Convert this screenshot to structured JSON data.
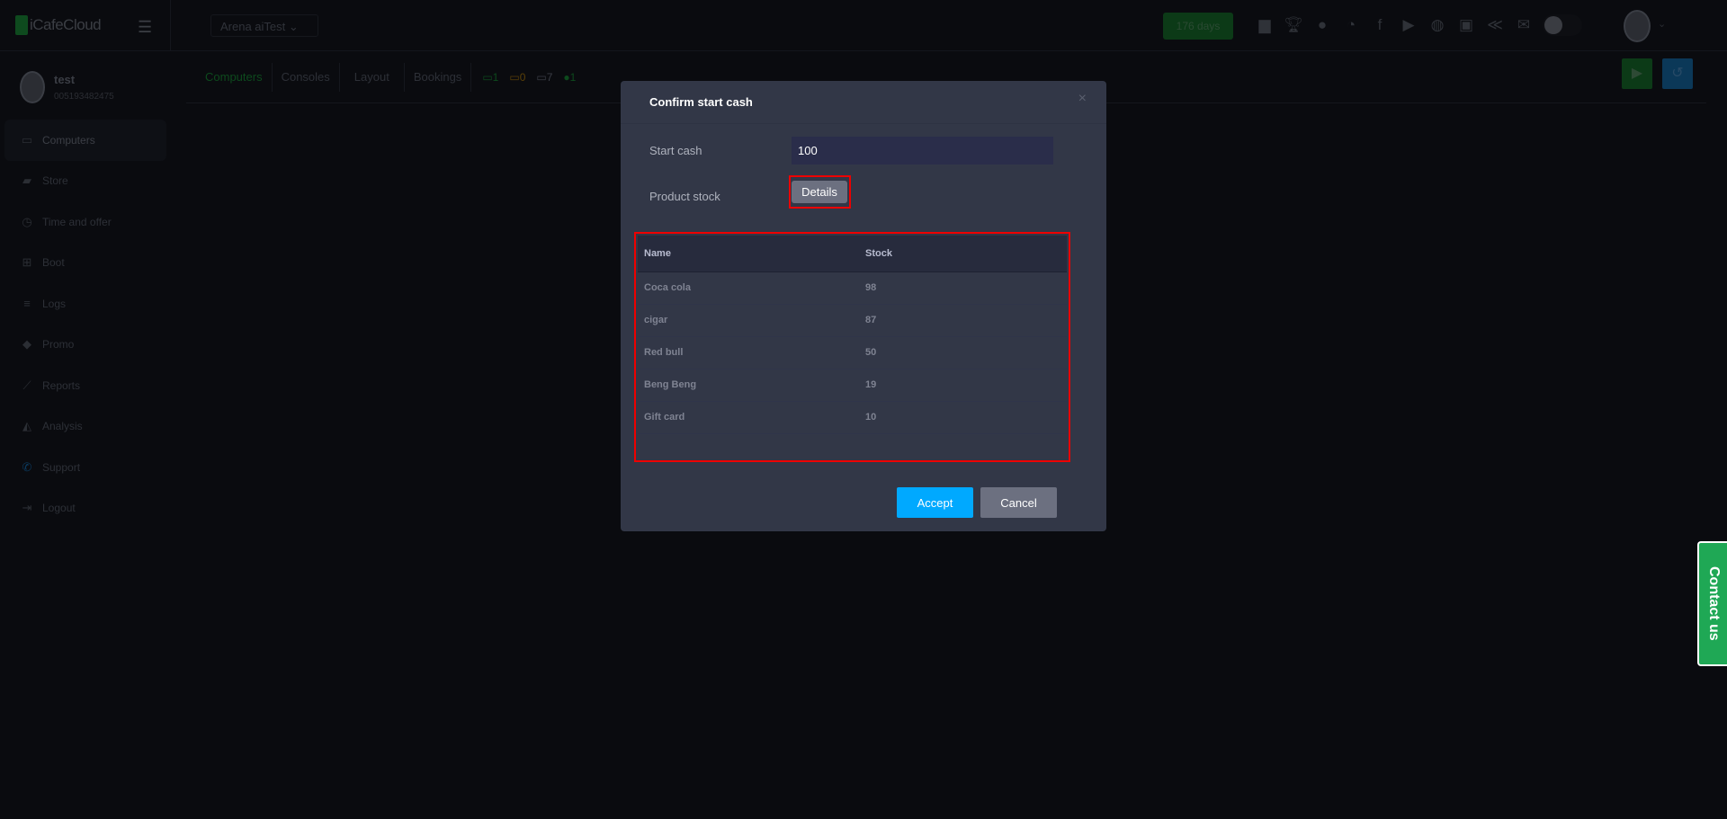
{
  "header": {
    "logo": "iCafeCloud",
    "center": "Arena aiTest",
    "days": "176 days",
    "icons": [
      "ranking-icon",
      "trophy-icon",
      "users-icon",
      "rss-icon",
      "facebook-icon",
      "youtube-icon",
      "globe-icon",
      "icafe-icon",
      "brand-icon",
      "mail-icon"
    ]
  },
  "user": {
    "name": "test",
    "id": "005193482475"
  },
  "sidebar": {
    "items": [
      {
        "label": "Computers",
        "icon": "monitor-icon"
      },
      {
        "label": "Store",
        "icon": "bag-icon"
      },
      {
        "label": "Time and offer",
        "icon": "stopwatch-icon"
      },
      {
        "label": "Boot",
        "icon": "windows-icon"
      },
      {
        "label": "Logs",
        "icon": "list-icon"
      },
      {
        "label": "Promo",
        "icon": "tag-icon"
      },
      {
        "label": "Reports",
        "icon": "chart-icon"
      },
      {
        "label": "Analysis",
        "icon": "area-chart-icon"
      },
      {
        "label": "Support",
        "icon": "phone-icon"
      },
      {
        "label": "Logout",
        "icon": "logout-icon"
      }
    ]
  },
  "tabs": [
    "Computers",
    "Consoles",
    "Layout",
    "Bookings"
  ],
  "stats": [
    {
      "value": "1",
      "color": "#0d4a1d"
    },
    {
      "value": "0",
      "color": "#5a4008"
    },
    {
      "value": "7",
      "color": "#3a3d45"
    },
    {
      "value": "1",
      "color": "#0d4a1d"
    }
  ],
  "modal": {
    "title": "Confirm start cash",
    "start_cash_label": "Start cash",
    "start_cash_value": "100",
    "product_stock_label": "Product stock",
    "details": "Details",
    "columns": [
      "Name",
      "Stock"
    ],
    "rows": [
      [
        "Coca cola",
        "98"
      ],
      [
        "cigar",
        "87"
      ],
      [
        "Red bull",
        "50"
      ],
      [
        "Beng Beng",
        "19"
      ],
      [
        "Gift card",
        "10"
      ]
    ],
    "accept": "Accept",
    "cancel": "Cancel"
  },
  "contact": "Contact us"
}
